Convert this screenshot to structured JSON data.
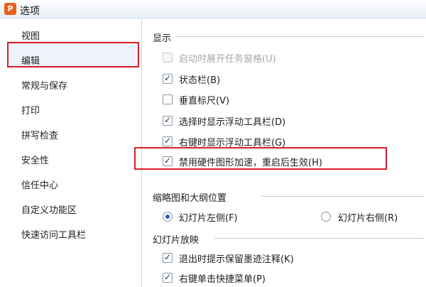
{
  "window": {
    "title": "选项",
    "icon_letter": "P"
  },
  "sidebar": {
    "items": [
      {
        "label": "视图",
        "selected": true
      },
      {
        "label": "编辑"
      },
      {
        "label": "常规与保存"
      },
      {
        "label": "打印"
      },
      {
        "label": "拼写检查"
      },
      {
        "label": "安全性"
      },
      {
        "label": "信任中心"
      },
      {
        "label": "自定义功能区"
      },
      {
        "label": "快速访问工具栏"
      }
    ]
  },
  "display": {
    "title": "显示",
    "options": [
      {
        "label": "启动时展开任务窗格(U)",
        "checked": false,
        "disabled": true
      },
      {
        "label": "状态栏(B)",
        "checked": true
      },
      {
        "label": "垂直标尺(V)",
        "checked": false
      },
      {
        "label": "选择时显示浮动工具栏(D)",
        "checked": true
      },
      {
        "label": "右键时显示浮动工具栏(G)",
        "checked": true
      },
      {
        "label": "禁用硬件图形加速，重启后生效(H)",
        "checked": true
      }
    ]
  },
  "thumbnail": {
    "title": "缩略图和大纲位置",
    "options": [
      {
        "label": "幻灯片左侧(F)",
        "selected": true
      },
      {
        "label": "幻灯片右侧(R)",
        "selected": false
      }
    ]
  },
  "slideshow": {
    "title": "幻灯片放映",
    "options": [
      {
        "label": "退出时提示保留墨迹注释(K)",
        "checked": true
      },
      {
        "label": "右键单击快捷菜单(P)",
        "checked": true
      }
    ]
  },
  "colors": {
    "highlight": "#d61f2a",
    "accent": "#e8601f"
  }
}
